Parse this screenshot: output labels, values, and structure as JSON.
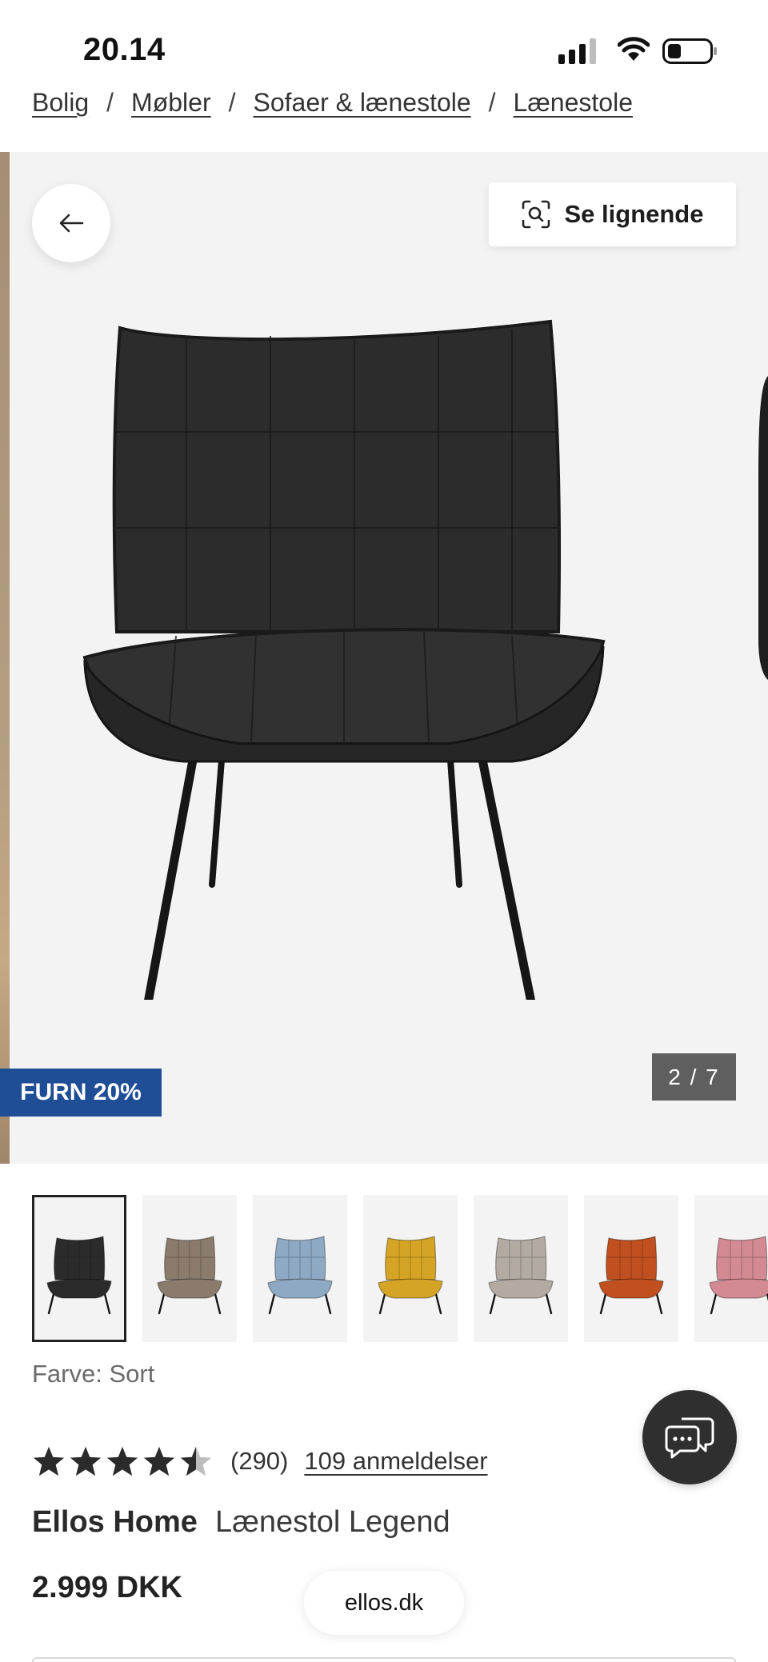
{
  "status_bar": {
    "time": "20.14",
    "icons": [
      "signal-icon",
      "wifi-icon",
      "battery-icon"
    ]
  },
  "breadcrumb": {
    "items": [
      "Bolig",
      "Møbler",
      "Sofaer & lænestole",
      "Lænestole"
    ],
    "separator": "/"
  },
  "gallery": {
    "back_icon": "arrow-left-icon",
    "similar_label": "Se lignende",
    "similar_icon": "visual-search-icon",
    "promo_badge": "FURN 20%",
    "counter": "2 / 7",
    "promo_color": "#1f4e97"
  },
  "thumbnails": [
    {
      "color_name": "black",
      "color": "#2b2b2b",
      "selected": true
    },
    {
      "color_name": "taupe",
      "color": "#8a7b6d",
      "selected": false
    },
    {
      "color_name": "light-blue",
      "color": "#8ea9c4",
      "selected": false
    },
    {
      "color_name": "mustard",
      "color": "#d6a424",
      "selected": false
    },
    {
      "color_name": "light-grey",
      "color": "#b3aba2",
      "selected": false
    },
    {
      "color_name": "rust",
      "color": "#c0501f",
      "selected": false
    },
    {
      "color_name": "pink",
      "color": "#d48a93",
      "selected": false
    }
  ],
  "product": {
    "color_label": "Farve: Sort",
    "rating": 4.5,
    "rating_count": "(290)",
    "reviews_link": "109 anmeldelser",
    "brand": "Ellos Home",
    "name": "Lænestol Legend",
    "price": "2.999 DKK"
  },
  "chat": {
    "icon": "chat-icon"
  },
  "browser": {
    "domain": "ellos.dk"
  }
}
